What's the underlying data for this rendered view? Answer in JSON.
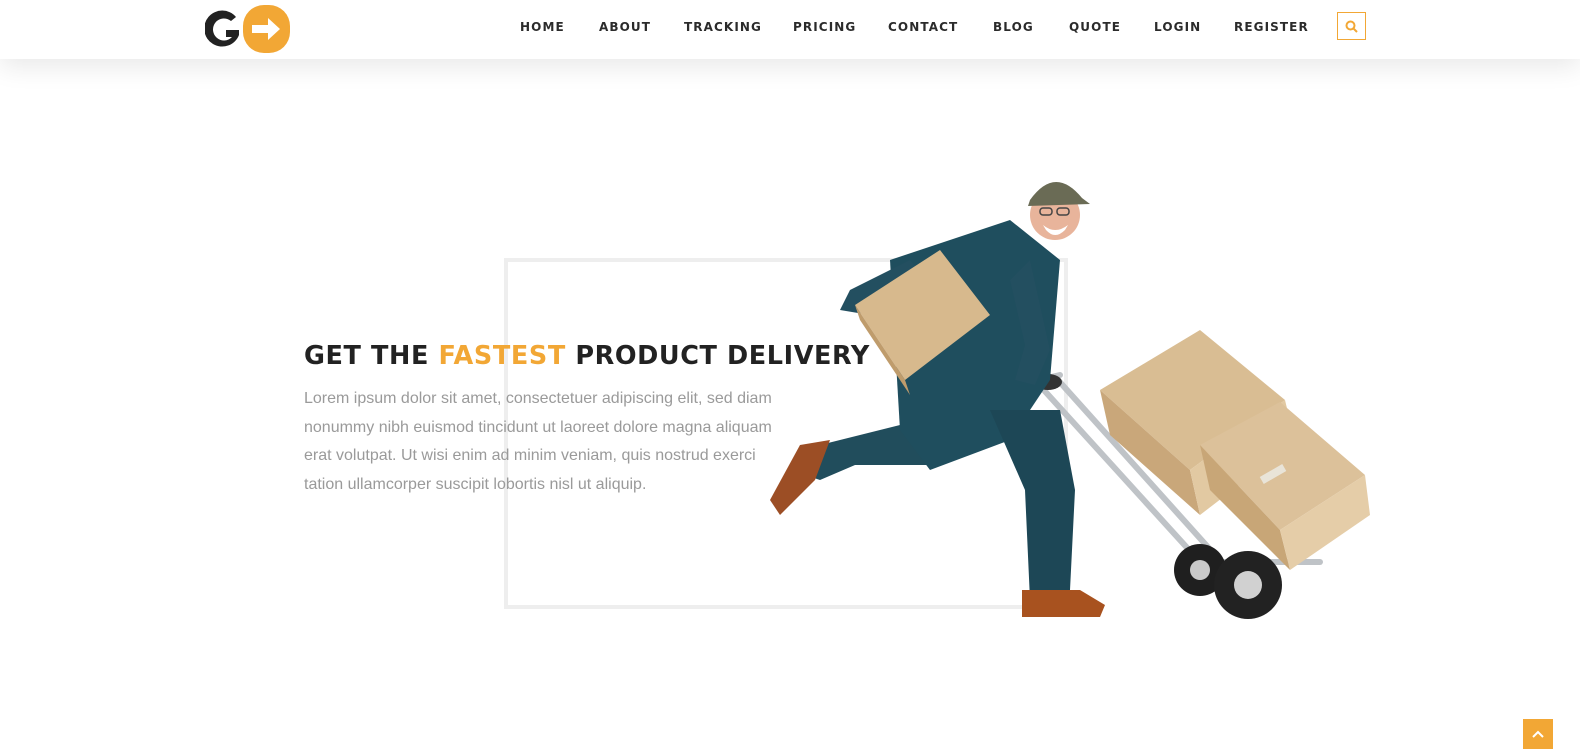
{
  "nav": {
    "items": [
      {
        "label": "HOME"
      },
      {
        "label": "ABOUT"
      },
      {
        "label": "TRACKING"
      },
      {
        "label": "PRICING"
      },
      {
        "label": "CONTACT"
      },
      {
        "label": "BLOG"
      },
      {
        "label": "QUOTE"
      },
      {
        "label": "LOGIN"
      },
      {
        "label": "REGISTER"
      }
    ],
    "search_icon": "search-icon"
  },
  "hero": {
    "title_prefix": "GET THE ",
    "title_accent": "FASTEST",
    "title_suffix": " PRODUCT DELIVERY",
    "body": "Lorem ipsum dolor sit amet, consectetuer adipiscing elit, sed diam nonummy nibh euismod tincidunt ut laoreet dolore magna aliquam erat volutpat. Ut wisi enim ad minim veniam, quis nostrud exerci tation ullamcorper suscipit lobortis nisl ut aliquip."
  },
  "colors": {
    "accent": "#f2a735",
    "dark": "#222222",
    "body_text": "#9a9a9a"
  },
  "scroll_top_icon": "chevron-up-icon"
}
